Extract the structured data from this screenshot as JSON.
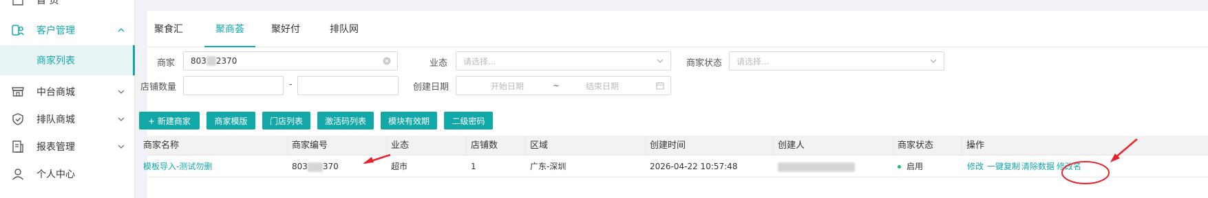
{
  "sidebar": {
    "items": [
      {
        "label": "首 页"
      },
      {
        "label": "客户管理"
      },
      {
        "label": "商家列表"
      },
      {
        "label": "中台商城"
      },
      {
        "label": "排队商城"
      },
      {
        "label": "报表管理"
      },
      {
        "label": "个人中心"
      }
    ]
  },
  "tabs": [
    "聚食汇",
    "聚商荟",
    "聚好付",
    "排队网"
  ],
  "filters": {
    "merchant_label": "商家",
    "merchant_value_prefix": "803",
    "merchant_value_suffix": "2370",
    "biz_label": "业态",
    "biz_placeholder": "请选择...",
    "status_label": "商家状态",
    "status_placeholder": "请选择...",
    "store_count_label": "店铺数量",
    "range_sep": "-",
    "created_label": "创建日期",
    "start_placeholder": "开始日期",
    "date_sep": "~",
    "end_placeholder": "结束日期"
  },
  "buttons": [
    "+ 新建商家",
    "商家模版",
    "门店列表",
    "激活码列表",
    "模块有效期",
    "二级密码"
  ],
  "table": {
    "headers": [
      "商家名称",
      "商家编号",
      "业态",
      "店铺数",
      "区域",
      "创建时间",
      "创建人",
      "商家状态",
      "操作"
    ],
    "row": {
      "name": "模板导入-测试勿删",
      "code_prefix": "803",
      "code_suffix": "370",
      "biz": "超市",
      "store_count": "1",
      "region": "广东-深圳",
      "created_at": "2026-04-22 10:57:48",
      "status": "启用",
      "actions": [
        "修改",
        "一键复制",
        "清除数据",
        "修改名"
      ]
    }
  },
  "colors": {
    "accent": "#13a8a8",
    "annotation": "#e8232b",
    "status_dot": "#19be6b"
  }
}
